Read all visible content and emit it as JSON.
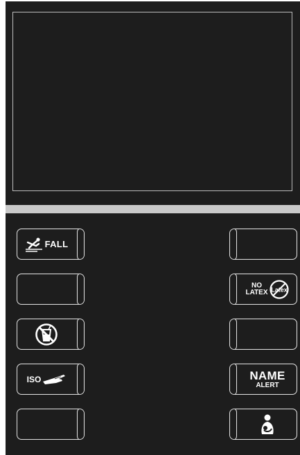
{
  "colors": {
    "panel": "#1d1d1d",
    "outline": "#e6e6e6",
    "divider": "#c9c9c9",
    "text": "#ffffff"
  },
  "tiles": {
    "fall": {
      "label": "FALL",
      "icon": "slip-fall-icon"
    },
    "no_liquids": {
      "icon": "no-liquids-icon"
    },
    "iso": {
      "label": "ISO",
      "icon": "gloved-hand-icon"
    },
    "no_latex": {
      "line1": "NO",
      "line2": "LATEX",
      "icon_text": "Latex",
      "icon": "no-latex-icon"
    },
    "name_alert": {
      "line1": "NAME",
      "line2": "ALERT"
    },
    "mother_baby": {
      "icon": "mother-baby-icon"
    }
  }
}
